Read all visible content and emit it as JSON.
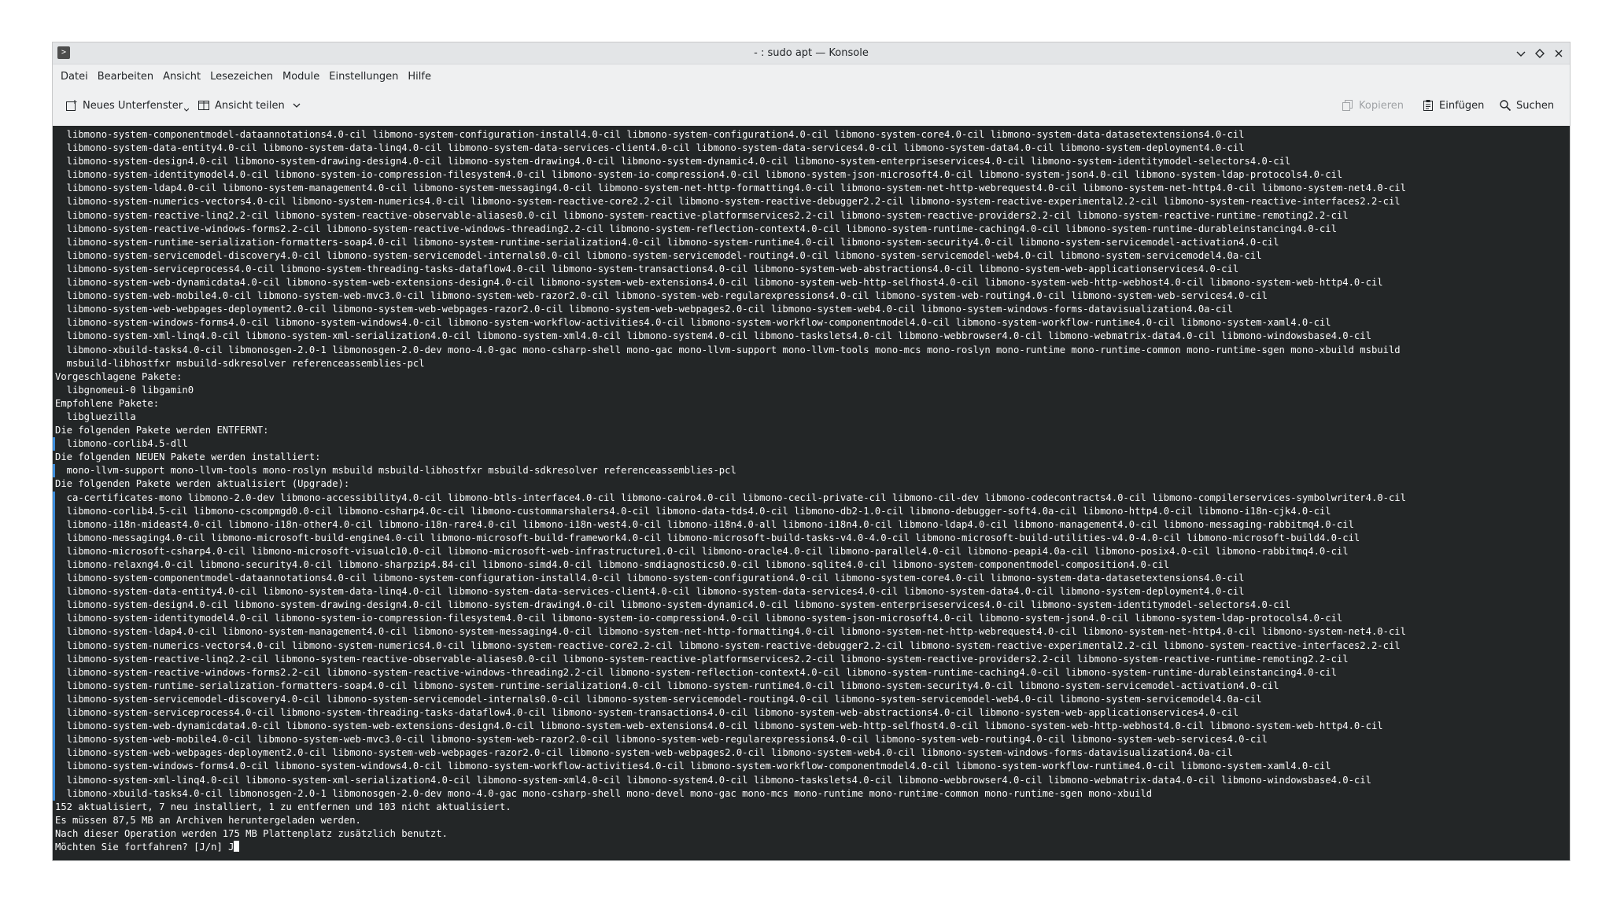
{
  "window": {
    "title": "- : sudo apt — Konsole",
    "app_icon_glyph": ">"
  },
  "menubar": {
    "items": [
      "Datei",
      "Bearbeiten",
      "Ansicht",
      "Lesezeichen",
      "Module",
      "Einstellungen",
      "Hilfe"
    ]
  },
  "toolbar": {
    "new_tab_label": "Neues Unterfenster",
    "split_view_label": "Ansicht teilen",
    "copy_label": "Kopieren",
    "paste_label": "Einfügen",
    "search_label": "Suchen"
  },
  "colors": {
    "terminal_bg": "#232627",
    "terminal_fg": "#fcfcfc",
    "marker": "#3d8ddb"
  },
  "terminal": {
    "lines": [
      {
        "text": "  libmono-system-componentmodel-dataannotations4.0-cil libmono-system-configuration-install4.0-cil libmono-system-configuration4.0-cil libmono-system-core4.0-cil libmono-system-data-datasetextensions4.0-cil",
        "marker": false
      },
      {
        "text": "  libmono-system-data-entity4.0-cil libmono-system-data-linq4.0-cil libmono-system-data-services-client4.0-cil libmono-system-data-services4.0-cil libmono-system-data4.0-cil libmono-system-deployment4.0-cil",
        "marker": false
      },
      {
        "text": "  libmono-system-design4.0-cil libmono-system-drawing-design4.0-cil libmono-system-drawing4.0-cil libmono-system-dynamic4.0-cil libmono-system-enterpriseservices4.0-cil libmono-system-identitymodel-selectors4.0-cil",
        "marker": false
      },
      {
        "text": "  libmono-system-identitymodel4.0-cil libmono-system-io-compression-filesystem4.0-cil libmono-system-io-compression4.0-cil libmono-system-json-microsoft4.0-cil libmono-system-json4.0-cil libmono-system-ldap-protocols4.0-cil",
        "marker": false
      },
      {
        "text": "  libmono-system-ldap4.0-cil libmono-system-management4.0-cil libmono-system-messaging4.0-cil libmono-system-net-http-formatting4.0-cil libmono-system-net-http-webrequest4.0-cil libmono-system-net-http4.0-cil libmono-system-net4.0-cil",
        "marker": false
      },
      {
        "text": "  libmono-system-numerics-vectors4.0-cil libmono-system-numerics4.0-cil libmono-system-reactive-core2.2-cil libmono-system-reactive-debugger2.2-cil libmono-system-reactive-experimental2.2-cil libmono-system-reactive-interfaces2.2-cil",
        "marker": false
      },
      {
        "text": "  libmono-system-reactive-linq2.2-cil libmono-system-reactive-observable-aliases0.0-cil libmono-system-reactive-platformservices2.2-cil libmono-system-reactive-providers2.2-cil libmono-system-reactive-runtime-remoting2.2-cil",
        "marker": false
      },
      {
        "text": "  libmono-system-reactive-windows-forms2.2-cil libmono-system-reactive-windows-threading2.2-cil libmono-system-reflection-context4.0-cil libmono-system-runtime-caching4.0-cil libmono-system-runtime-durableinstancing4.0-cil",
        "marker": false
      },
      {
        "text": "  libmono-system-runtime-serialization-formatters-soap4.0-cil libmono-system-runtime-serialization4.0-cil libmono-system-runtime4.0-cil libmono-system-security4.0-cil libmono-system-servicemodel-activation4.0-cil",
        "marker": false
      },
      {
        "text": "  libmono-system-servicemodel-discovery4.0-cil libmono-system-servicemodel-internals0.0-cil libmono-system-servicemodel-routing4.0-cil libmono-system-servicemodel-web4.0-cil libmono-system-servicemodel4.0a-cil",
        "marker": false
      },
      {
        "text": "  libmono-system-serviceprocess4.0-cil libmono-system-threading-tasks-dataflow4.0-cil libmono-system-transactions4.0-cil libmono-system-web-abstractions4.0-cil libmono-system-web-applicationservices4.0-cil",
        "marker": false
      },
      {
        "text": "  libmono-system-web-dynamicdata4.0-cil libmono-system-web-extensions-design4.0-cil libmono-system-web-extensions4.0-cil libmono-system-web-http-selfhost4.0-cil libmono-system-web-http-webhost4.0-cil libmono-system-web-http4.0-cil",
        "marker": false
      },
      {
        "text": "  libmono-system-web-mobile4.0-cil libmono-system-web-mvc3.0-cil libmono-system-web-razor2.0-cil libmono-system-web-regularexpressions4.0-cil libmono-system-web-routing4.0-cil libmono-system-web-services4.0-cil",
        "marker": false
      },
      {
        "text": "  libmono-system-web-webpages-deployment2.0-cil libmono-system-web-webpages-razor2.0-cil libmono-system-web-webpages2.0-cil libmono-system-web4.0-cil libmono-system-windows-forms-datavisualization4.0a-cil",
        "marker": false
      },
      {
        "text": "  libmono-system-windows-forms4.0-cil libmono-system-windows4.0-cil libmono-system-workflow-activities4.0-cil libmono-system-workflow-componentmodel4.0-cil libmono-system-workflow-runtime4.0-cil libmono-system-xaml4.0-cil",
        "marker": false
      },
      {
        "text": "  libmono-system-xml-linq4.0-cil libmono-system-xml-serialization4.0-cil libmono-system-xml4.0-cil libmono-system4.0-cil libmono-taskslets4.0-cil libmono-webbrowser4.0-cil libmono-webmatrix-data4.0-cil libmono-windowsbase4.0-cil",
        "marker": false
      },
      {
        "text": "  libmono-xbuild-tasks4.0-cil libmonosgen-2.0-1 libmonosgen-2.0-dev mono-4.0-gac mono-csharp-shell mono-gac mono-llvm-support mono-llvm-tools mono-mcs mono-roslyn mono-runtime mono-runtime-common mono-runtime-sgen mono-xbuild msbuild",
        "marker": false
      },
      {
        "text": "  msbuild-libhostfxr msbuild-sdkresolver referenceassemblies-pcl",
        "marker": false
      },
      {
        "text": "Vorgeschlagene Pakete:",
        "marker": false
      },
      {
        "text": "  libgnomeui-0 libgamin0",
        "marker": false
      },
      {
        "text": "Empfohlene Pakete:",
        "marker": false
      },
      {
        "text": "  libgluezilla",
        "marker": false
      },
      {
        "text": "Die folgenden Pakete werden ENTFERNT:",
        "marker": false
      },
      {
        "text": "  libmono-corlib4.5-dll",
        "marker": true
      },
      {
        "text": "Die folgenden NEUEN Pakete werden installiert:",
        "marker": false
      },
      {
        "text": "  mono-llvm-support mono-llvm-tools mono-roslyn msbuild msbuild-libhostfxr msbuild-sdkresolver referenceassemblies-pcl",
        "marker": true
      },
      {
        "text": "Die folgenden Pakete werden aktualisiert (Upgrade):",
        "marker": false
      },
      {
        "text": "  ca-certificates-mono libmono-2.0-dev libmono-accessibility4.0-cil libmono-btls-interface4.0-cil libmono-cairo4.0-cil libmono-cecil-private-cil libmono-cil-dev libmono-codecontracts4.0-cil libmono-compilerservices-symbolwriter4.0-cil",
        "marker": true
      },
      {
        "text": "  libmono-corlib4.5-cil libmono-cscompmgd0.0-cil libmono-csharp4.0c-cil libmono-custommarshalers4.0-cil libmono-data-tds4.0-cil libmono-db2-1.0-cil libmono-debugger-soft4.0a-cil libmono-http4.0-cil libmono-i18n-cjk4.0-cil",
        "marker": true
      },
      {
        "text": "  libmono-i18n-mideast4.0-cil libmono-i18n-other4.0-cil libmono-i18n-rare4.0-cil libmono-i18n-west4.0-cil libmono-i18n4.0-all libmono-i18n4.0-cil libmono-ldap4.0-cil libmono-management4.0-cil libmono-messaging-rabbitmq4.0-cil",
        "marker": true
      },
      {
        "text": "  libmono-messaging4.0-cil libmono-microsoft-build-engine4.0-cil libmono-microsoft-build-framework4.0-cil libmono-microsoft-build-tasks-v4.0-4.0-cil libmono-microsoft-build-utilities-v4.0-4.0-cil libmono-microsoft-build4.0-cil",
        "marker": true
      },
      {
        "text": "  libmono-microsoft-csharp4.0-cil libmono-microsoft-visualc10.0-cil libmono-microsoft-web-infrastructure1.0-cil libmono-oracle4.0-cil libmono-parallel4.0-cil libmono-peapi4.0a-cil libmono-posix4.0-cil libmono-rabbitmq4.0-cil",
        "marker": true
      },
      {
        "text": "  libmono-relaxng4.0-cil libmono-security4.0-cil libmono-sharpzip4.84-cil libmono-simd4.0-cil libmono-smdiagnostics0.0-cil libmono-sqlite4.0-cil libmono-system-componentmodel-composition4.0-cil",
        "marker": true
      },
      {
        "text": "  libmono-system-componentmodel-dataannotations4.0-cil libmono-system-configuration-install4.0-cil libmono-system-configuration4.0-cil libmono-system-core4.0-cil libmono-system-data-datasetextensions4.0-cil",
        "marker": true
      },
      {
        "text": "  libmono-system-data-entity4.0-cil libmono-system-data-linq4.0-cil libmono-system-data-services-client4.0-cil libmono-system-data-services4.0-cil libmono-system-data4.0-cil libmono-system-deployment4.0-cil",
        "marker": true
      },
      {
        "text": "  libmono-system-design4.0-cil libmono-system-drawing-design4.0-cil libmono-system-drawing4.0-cil libmono-system-dynamic4.0-cil libmono-system-enterpriseservices4.0-cil libmono-system-identitymodel-selectors4.0-cil",
        "marker": true
      },
      {
        "text": "  libmono-system-identitymodel4.0-cil libmono-system-io-compression-filesystem4.0-cil libmono-system-io-compression4.0-cil libmono-system-json-microsoft4.0-cil libmono-system-json4.0-cil libmono-system-ldap-protocols4.0-cil",
        "marker": true
      },
      {
        "text": "  libmono-system-ldap4.0-cil libmono-system-management4.0-cil libmono-system-messaging4.0-cil libmono-system-net-http-formatting4.0-cil libmono-system-net-http-webrequest4.0-cil libmono-system-net-http4.0-cil libmono-system-net4.0-cil",
        "marker": true
      },
      {
        "text": "  libmono-system-numerics-vectors4.0-cil libmono-system-numerics4.0-cil libmono-system-reactive-core2.2-cil libmono-system-reactive-debugger2.2-cil libmono-system-reactive-experimental2.2-cil libmono-system-reactive-interfaces2.2-cil",
        "marker": true
      },
      {
        "text": "  libmono-system-reactive-linq2.2-cil libmono-system-reactive-observable-aliases0.0-cil libmono-system-reactive-platformservices2.2-cil libmono-system-reactive-providers2.2-cil libmono-system-reactive-runtime-remoting2.2-cil",
        "marker": true
      },
      {
        "text": "  libmono-system-reactive-windows-forms2.2-cil libmono-system-reactive-windows-threading2.2-cil libmono-system-reflection-context4.0-cil libmono-system-runtime-caching4.0-cil libmono-system-runtime-durableinstancing4.0-cil",
        "marker": true
      },
      {
        "text": "  libmono-system-runtime-serialization-formatters-soap4.0-cil libmono-system-runtime-serialization4.0-cil libmono-system-runtime4.0-cil libmono-system-security4.0-cil libmono-system-servicemodel-activation4.0-cil",
        "marker": true
      },
      {
        "text": "  libmono-system-servicemodel-discovery4.0-cil libmono-system-servicemodel-internals0.0-cil libmono-system-servicemodel-routing4.0-cil libmono-system-servicemodel-web4.0-cil libmono-system-servicemodel4.0a-cil",
        "marker": true
      },
      {
        "text": "  libmono-system-serviceprocess4.0-cil libmono-system-threading-tasks-dataflow4.0-cil libmono-system-transactions4.0-cil libmono-system-web-abstractions4.0-cil libmono-system-web-applicationservices4.0-cil",
        "marker": true
      },
      {
        "text": "  libmono-system-web-dynamicdata4.0-cil libmono-system-web-extensions-design4.0-cil libmono-system-web-extensions4.0-cil libmono-system-web-http-selfhost4.0-cil libmono-system-web-http-webhost4.0-cil libmono-system-web-http4.0-cil",
        "marker": true
      },
      {
        "text": "  libmono-system-web-mobile4.0-cil libmono-system-web-mvc3.0-cil libmono-system-web-razor2.0-cil libmono-system-web-regularexpressions4.0-cil libmono-system-web-routing4.0-cil libmono-system-web-services4.0-cil",
        "marker": true
      },
      {
        "text": "  libmono-system-web-webpages-deployment2.0-cil libmono-system-web-webpages-razor2.0-cil libmono-system-web-webpages2.0-cil libmono-system-web4.0-cil libmono-system-windows-forms-datavisualization4.0a-cil",
        "marker": true
      },
      {
        "text": "  libmono-system-windows-forms4.0-cil libmono-system-windows4.0-cil libmono-system-workflow-activities4.0-cil libmono-system-workflow-componentmodel4.0-cil libmono-system-workflow-runtime4.0-cil libmono-system-xaml4.0-cil",
        "marker": true
      },
      {
        "text": "  libmono-system-xml-linq4.0-cil libmono-system-xml-serialization4.0-cil libmono-system-xml4.0-cil libmono-system4.0-cil libmono-taskslets4.0-cil libmono-webbrowser4.0-cil libmono-webmatrix-data4.0-cil libmono-windowsbase4.0-cil",
        "marker": true
      },
      {
        "text": "  libmono-xbuild-tasks4.0-cil libmonosgen-2.0-1 libmonosgen-2.0-dev mono-4.0-gac mono-csharp-shell mono-devel mono-gac mono-mcs mono-runtime mono-runtime-common mono-runtime-sgen mono-xbuild",
        "marker": true
      },
      {
        "text": "152 aktualisiert, 7 neu installiert, 1 zu entfernen und 103 nicht aktualisiert.",
        "marker": false
      },
      {
        "text": "Es müssen 87,5 MB an Archiven heruntergeladen werden.",
        "marker": false
      },
      {
        "text": "Nach dieser Operation werden 175 MB Plattenplatz zusätzlich benutzt.",
        "marker": false
      }
    ],
    "prompt_line": "Möchten Sie fortfahren? [J/n] J"
  }
}
